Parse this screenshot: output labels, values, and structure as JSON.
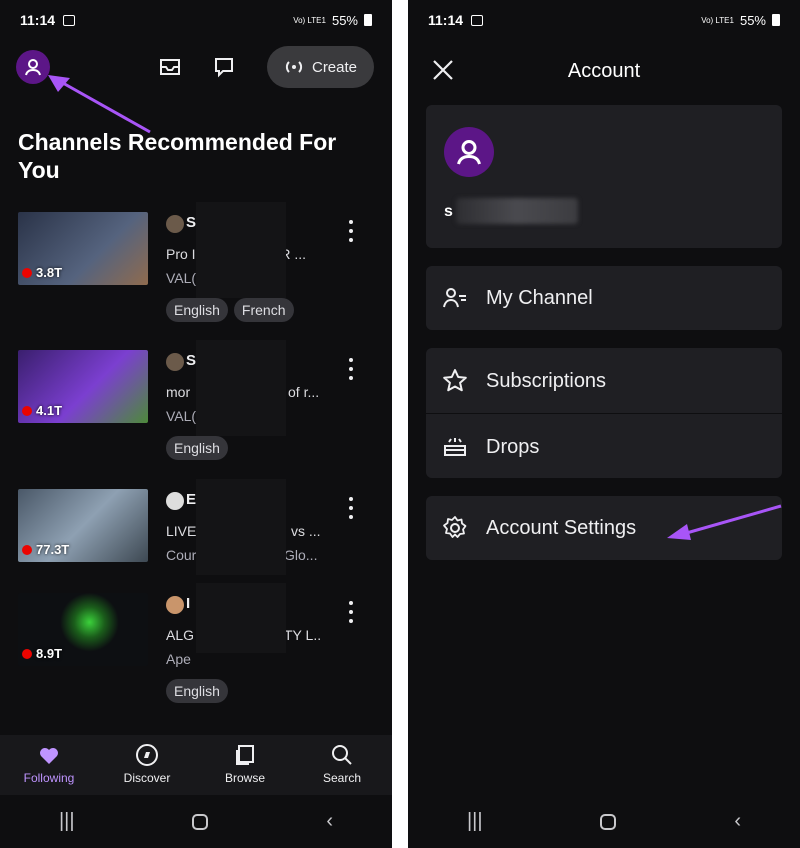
{
  "status_bar": {
    "time": "11:14",
    "battery": "55%",
    "network": "Vo) LTE1"
  },
  "left": {
    "create_label": "Create",
    "heading": "Channels Recommended For You",
    "recommendations": [
      {
        "viewers": "3.8T",
        "channel": "S",
        "title": "Pro I",
        "title_end": "ER ...",
        "game": "VAL(",
        "tags": [
          "English",
          "French"
        ],
        "thumb": "#3b4a66"
      },
      {
        "viewers": "4.1T",
        "channel": "S",
        "title": "mor",
        "title_end": "of r...",
        "game": "VAL(",
        "tags": [
          "English"
        ],
        "thumb": "#6a2fb0"
      },
      {
        "viewers": "77.3T",
        "channel": "E",
        "title": "LIVE",
        "title_end": "vs ...",
        "game": "Cour",
        "game_end": "Glo...",
        "tags": [],
        "thumb": "#5a6878"
      },
      {
        "viewers": "8.9T",
        "channel": "I",
        "title": "ALG",
        "title_end": "TY L...",
        "game": "Ape",
        "tags": [
          "English"
        ],
        "thumb": "#121418"
      }
    ],
    "tabs": [
      {
        "label": "Following",
        "icon": "heart-icon"
      },
      {
        "label": "Discover",
        "icon": "compass-icon"
      },
      {
        "label": "Browse",
        "icon": "browse-icon"
      },
      {
        "label": "Search",
        "icon": "search-icon"
      }
    ]
  },
  "right": {
    "title": "Account",
    "username_initial": "s",
    "menu": {
      "my_channel": "My Channel",
      "subscriptions": "Subscriptions",
      "drops": "Drops",
      "account_settings": "Account Settings"
    }
  },
  "colors": {
    "background": "#0e0e10",
    "card": "#1f1f23",
    "accent": "#9147ff",
    "annotation_arrow": "#a855f7",
    "live": "#eb0400"
  }
}
